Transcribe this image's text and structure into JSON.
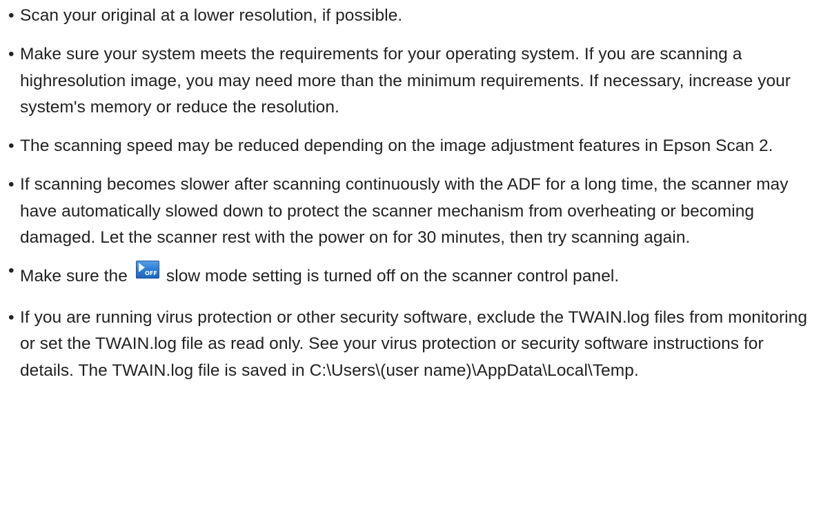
{
  "bullets": [
    "Scan your original at a lower resolution, if possible.",
    "Make sure your system meets the requirements for your operating system. If you are scanning a highresolution image, you may need more than the minimum requirements. If necessary, increase your system's memory or reduce the resolution.",
    "The scanning speed may be reduced depending on the image adjustment features in Epson Scan 2.",
    "If scanning becomes slower after scanning continuously with the ADF for a long time, the scanner may have automatically slowed down to protect the scanner mechanism from overheating or becoming damaged. Let the scanner rest with the power on for 30 minutes, then try scanning again.",
    {
      "before": "Make sure the",
      "icon": "slow-mode-off-icon",
      "icon_text": "OFF",
      "after": "slow mode setting is turned off on the scanner control panel."
    },
    "If you are running virus protection or other security software, exclude the TWAIN.log files from monitoring or set the TWAIN.log file as read only. See your virus protection or security software instructions for details. The TWAIN.log file is saved in C:\\Users\\(user name)\\AppData\\Local\\Temp."
  ],
  "bullet_char": "•"
}
